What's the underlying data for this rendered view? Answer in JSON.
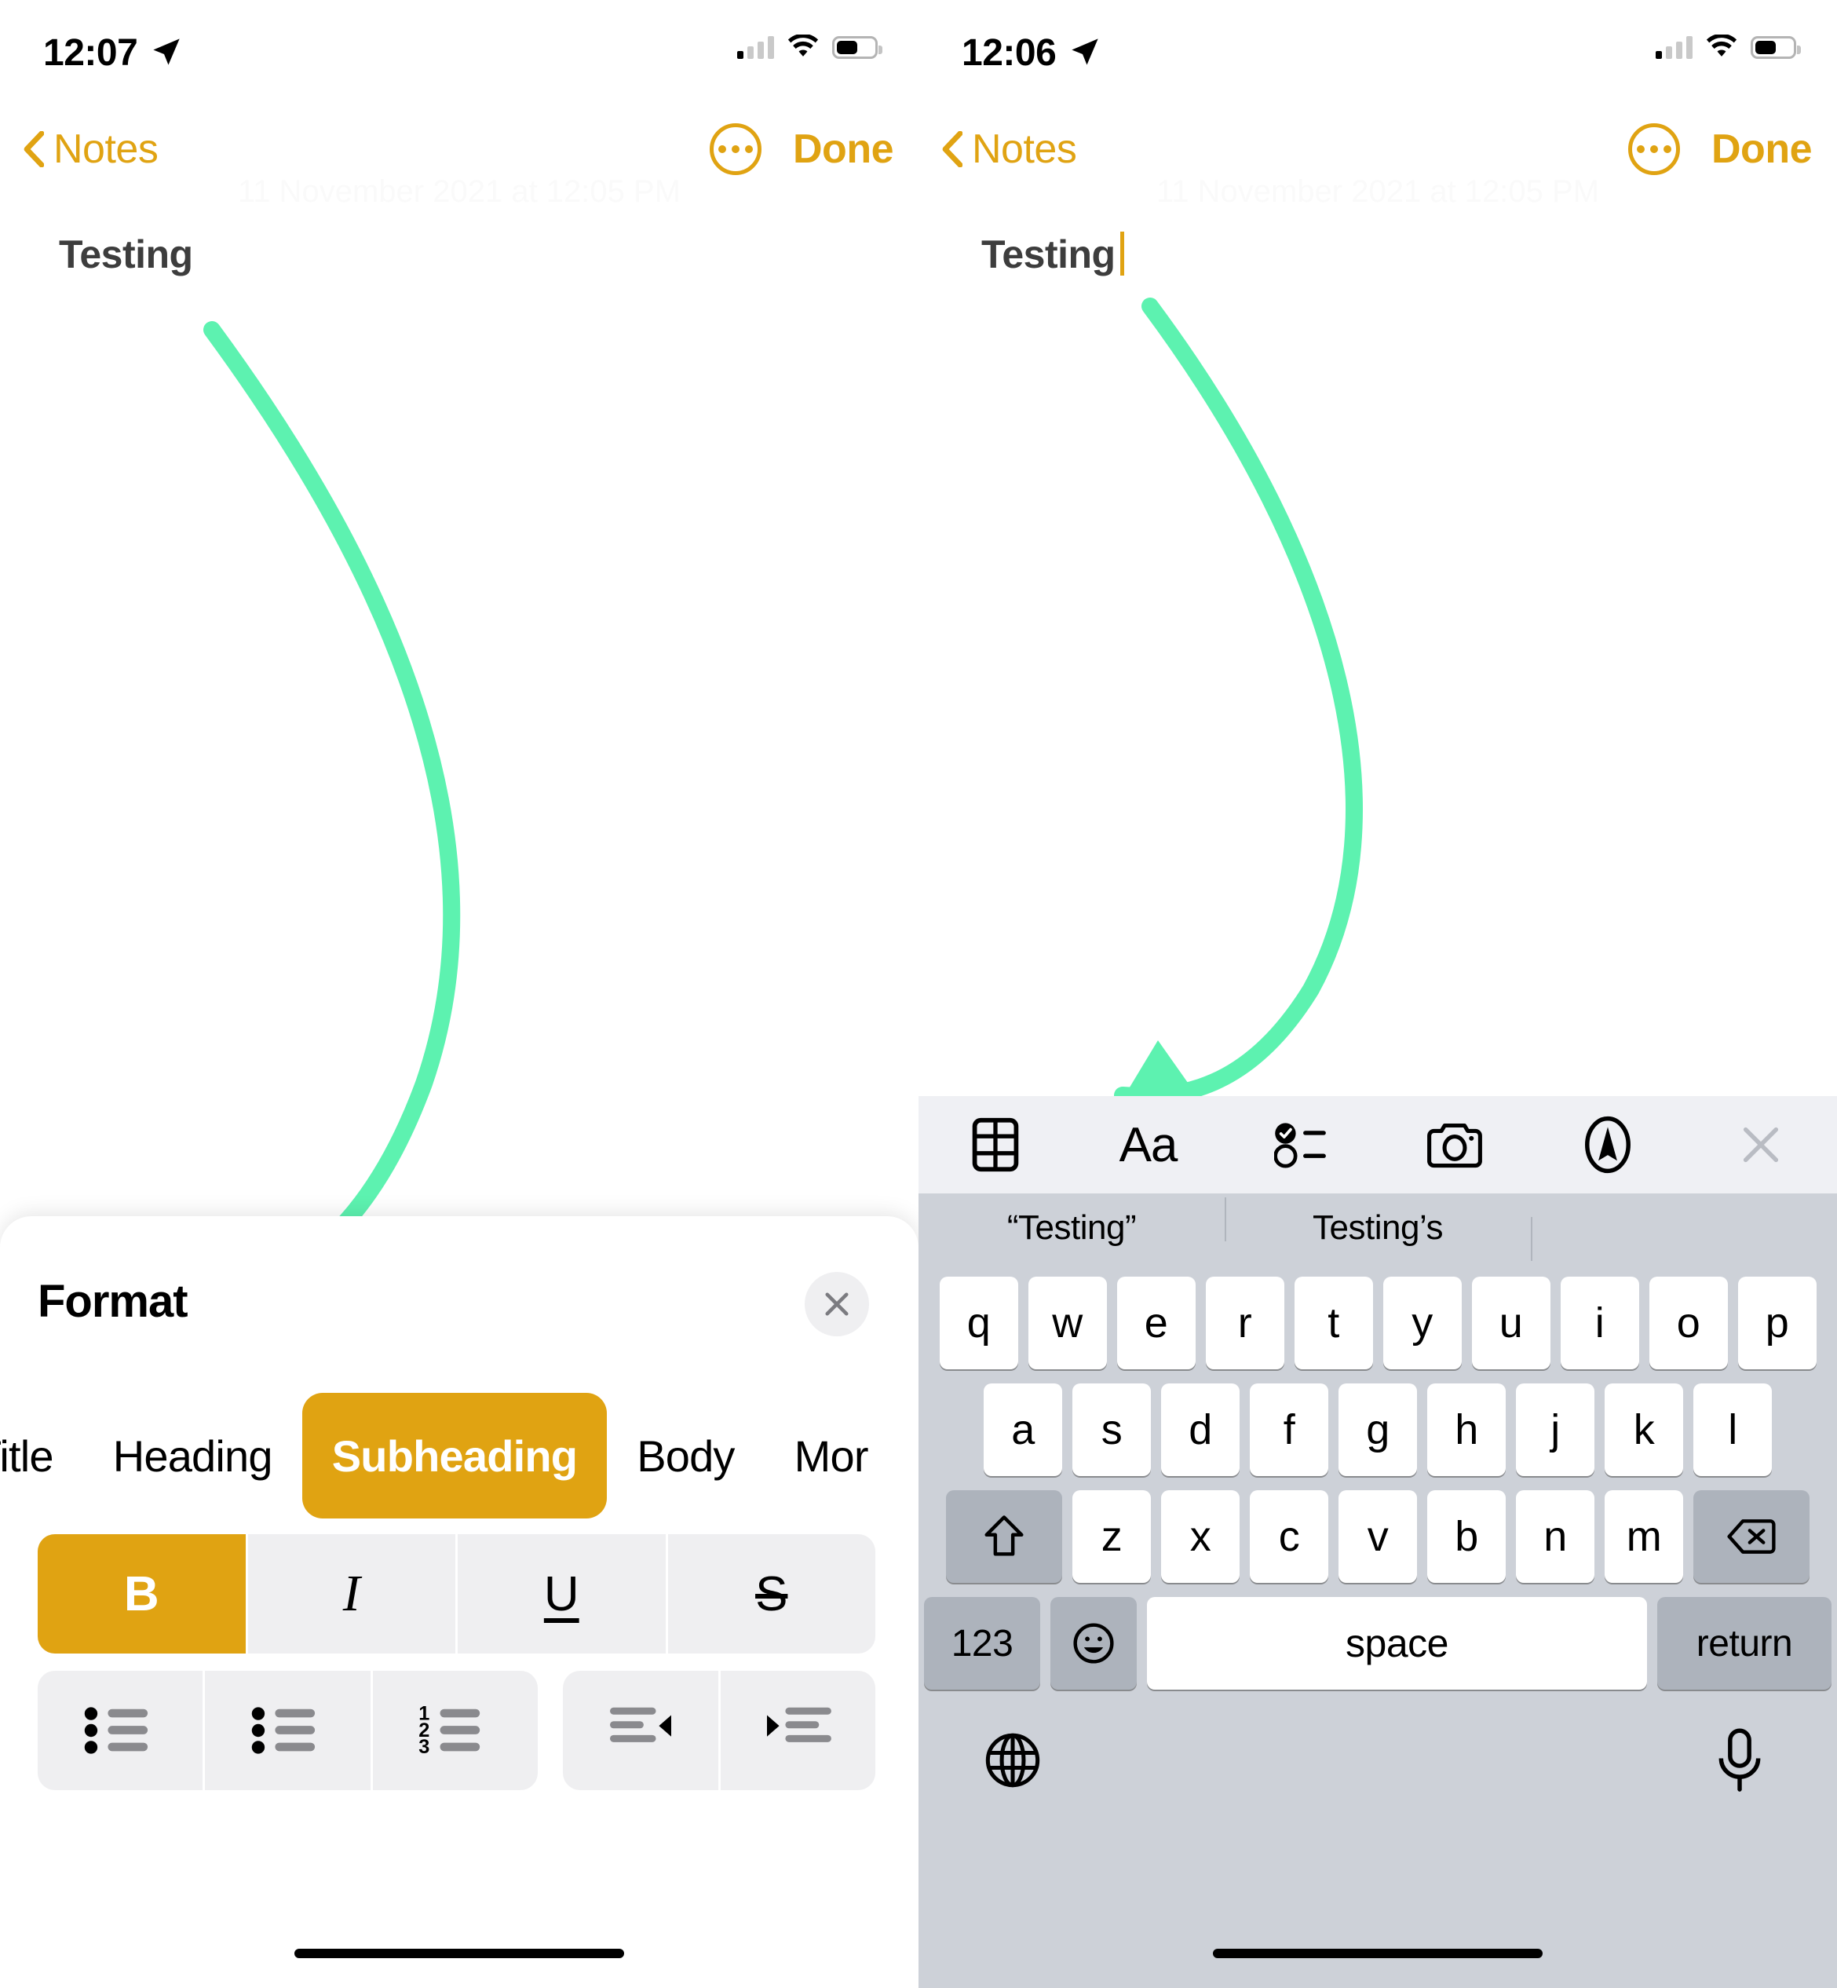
{
  "left_screen": {
    "status": {
      "time": "12:07",
      "location_icon": "location-arrow-icon",
      "cellular": "signal-bars-icon",
      "wifi": "wifi-icon",
      "battery": "battery-icon"
    },
    "nav": {
      "back_label": "Notes",
      "more_icon": "ellipsis-circle-icon",
      "done_label": "Done"
    },
    "note": {
      "date": "11 November 2021 at 12:05 PM",
      "title": "Testing"
    },
    "format_panel": {
      "heading": "Format",
      "close_icon": "close-icon",
      "styles": [
        {
          "label": "Title",
          "selected": false
        },
        {
          "label": "Heading",
          "selected": false
        },
        {
          "label": "Subheading",
          "selected": true
        },
        {
          "label": "Body",
          "selected": false
        },
        {
          "label": "Mor",
          "selected": false
        }
      ],
      "text_styles": [
        {
          "label": "B",
          "name": "bold",
          "selected": true
        },
        {
          "label": "I",
          "name": "italic",
          "selected": false
        },
        {
          "label": "U",
          "name": "underline",
          "selected": false
        },
        {
          "label": "S",
          "name": "strikethrough",
          "selected": false
        }
      ],
      "list_buttons": [
        {
          "name": "bulleted-list"
        },
        {
          "name": "dashed-list"
        },
        {
          "name": "numbered-list"
        },
        {
          "name": "outdent"
        },
        {
          "name": "indent"
        }
      ]
    }
  },
  "right_screen": {
    "status": {
      "time": "12:06",
      "location_icon": "location-arrow-icon",
      "cellular": "signal-bars-icon",
      "wifi": "wifi-icon",
      "battery": "battery-icon"
    },
    "nav": {
      "back_label": "Notes",
      "more_icon": "ellipsis-circle-icon",
      "done_label": "Done"
    },
    "note": {
      "date": "11 November 2021 at 12:05 PM",
      "title": "Testing"
    },
    "accessory_bar": [
      {
        "name": "table-icon"
      },
      {
        "name": "format-aa-icon",
        "label": "Aa"
      },
      {
        "name": "checklist-icon"
      },
      {
        "name": "camera-icon"
      },
      {
        "name": "markup-pen-icon"
      },
      {
        "name": "close-icon"
      }
    ],
    "predictions": [
      "“Testing”",
      "Testing’s",
      ""
    ],
    "keyboard": {
      "row1": [
        "q",
        "w",
        "e",
        "r",
        "t",
        "y",
        "u",
        "i",
        "o",
        "p"
      ],
      "row2": [
        "a",
        "s",
        "d",
        "f",
        "g",
        "h",
        "j",
        "k",
        "l"
      ],
      "row3_shift": "shift-icon",
      "row3": [
        "z",
        "x",
        "c",
        "v",
        "b",
        "n",
        "m"
      ],
      "row3_delete": "backspace-icon",
      "numbers_key": "123",
      "emoji_key": "emoji-icon",
      "space_key": "space",
      "return_key": "return",
      "globe_key": "globe-icon",
      "mic_key": "microphone-icon"
    }
  },
  "annotations": {
    "arrow_color": "#5df2b0",
    "left_arrow_target": "format-panel",
    "right_arrow_target": "format-aa-icon"
  }
}
